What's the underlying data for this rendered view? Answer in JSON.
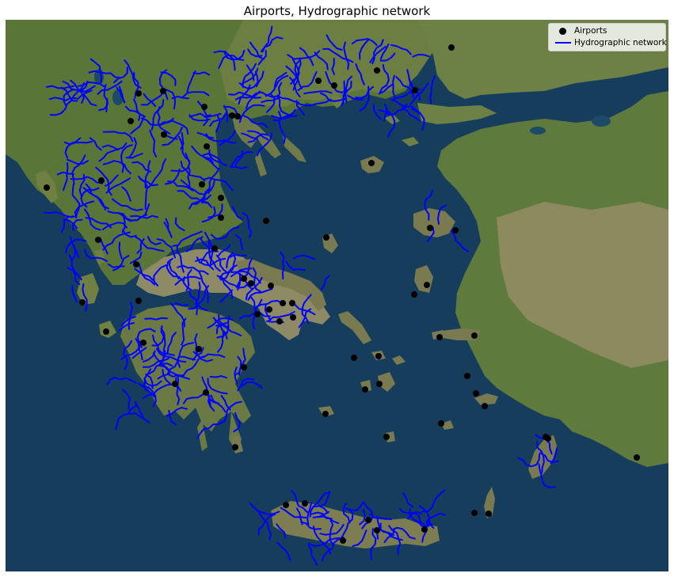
{
  "title": "Airports, Hydrographic network",
  "legend": {
    "placement": "top-right",
    "items": [
      {
        "label": "Airports",
        "kind": "marker",
        "color": "#000000"
      },
      {
        "label": "Hydrographic network",
        "kind": "line",
        "color": "#0000ff"
      }
    ]
  },
  "basemap": "satellite imagery",
  "colors": {
    "sea": "#163e5c",
    "land_green": "#5a7538",
    "land_brown": "#8f8a66",
    "rivers": "#0000ff",
    "airports": "#000000"
  },
  "airports": [
    {
      "id": "ap-01"
    },
    {
      "id": "ap-02"
    },
    {
      "id": "ap-03"
    },
    {
      "id": "ap-04"
    },
    {
      "id": "ap-05"
    },
    {
      "id": "ap-06"
    },
    {
      "id": "ap-07"
    },
    {
      "id": "ap-08"
    },
    {
      "id": "ap-09"
    },
    {
      "id": "ap-10"
    },
    {
      "id": "ap-11"
    },
    {
      "id": "ap-12"
    },
    {
      "id": "ap-13"
    },
    {
      "id": "ap-14"
    },
    {
      "id": "ap-15"
    },
    {
      "id": "ap-16"
    },
    {
      "id": "ap-17"
    },
    {
      "id": "ap-18"
    },
    {
      "id": "ap-19"
    },
    {
      "id": "ap-20"
    },
    {
      "id": "ap-21"
    },
    {
      "id": "ap-22"
    },
    {
      "id": "ap-23"
    },
    {
      "id": "ap-24"
    },
    {
      "id": "ap-25"
    },
    {
      "id": "ap-26"
    },
    {
      "id": "ap-27"
    },
    {
      "id": "ap-28"
    },
    {
      "id": "ap-29"
    },
    {
      "id": "ap-30"
    },
    {
      "id": "ap-31"
    },
    {
      "id": "ap-32"
    },
    {
      "id": "ap-33"
    },
    {
      "id": "ap-34"
    },
    {
      "id": "ap-35"
    },
    {
      "id": "ap-36"
    },
    {
      "id": "ap-37"
    },
    {
      "id": "ap-38"
    },
    {
      "id": "ap-39"
    },
    {
      "id": "ap-40"
    },
    {
      "id": "ap-41"
    },
    {
      "id": "ap-42"
    },
    {
      "id": "ap-43"
    },
    {
      "id": "ap-44"
    },
    {
      "id": "ap-45"
    },
    {
      "id": "ap-46"
    },
    {
      "id": "ap-47"
    },
    {
      "id": "ap-48"
    },
    {
      "id": "ap-49"
    },
    {
      "id": "ap-50"
    },
    {
      "id": "ap-51"
    },
    {
      "id": "ap-52"
    },
    {
      "id": "ap-53"
    },
    {
      "id": "ap-54"
    },
    {
      "id": "ap-55"
    },
    {
      "id": "ap-56"
    },
    {
      "id": "ap-57"
    },
    {
      "id": "ap-58"
    },
    {
      "id": "ap-59"
    },
    {
      "id": "ap-60"
    },
    {
      "id": "ap-61"
    },
    {
      "id": "ap-62"
    },
    {
      "id": "ap-63"
    },
    {
      "id": "ap-64"
    },
    {
      "id": "ap-65"
    },
    {
      "id": "ap-66"
    },
    {
      "id": "ap-67"
    },
    {
      "id": "ap-68"
    },
    {
      "id": "ap-69"
    }
  ]
}
